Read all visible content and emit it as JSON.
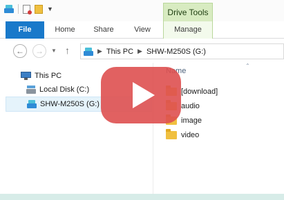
{
  "titlebar": {
    "context_tab_header": "Drive Tools",
    "qat_icons": [
      "drive-icon",
      "properties-icon",
      "new-folder-icon",
      "customize-qat-icon"
    ]
  },
  "ribbon": {
    "tabs": [
      {
        "label": "File"
      },
      {
        "label": "Home"
      },
      {
        "label": "Share"
      },
      {
        "label": "View"
      },
      {
        "label": "Manage"
      }
    ]
  },
  "address": {
    "crumbs": [
      {
        "label": "This PC"
      },
      {
        "label": "SHW-M250S (G:)"
      }
    ]
  },
  "navpane": {
    "items": [
      {
        "label": "This PC",
        "icon": "computer-icon"
      },
      {
        "label": "Local Disk (C:)",
        "icon": "local-disk-icon"
      },
      {
        "label": "SHW-M250S (G:)",
        "icon": "drive-icon",
        "selected": true
      }
    ]
  },
  "content": {
    "column_header": "Name",
    "files": [
      {
        "label": "[download]",
        "icon": "folder-icon"
      },
      {
        "label": "audio",
        "icon": "folder-icon"
      },
      {
        "label": "image",
        "icon": "folder-icon"
      },
      {
        "label": "video",
        "icon": "folder-icon"
      }
    ]
  },
  "overlay": {
    "icon": "play-icon",
    "color": "#de5050"
  }
}
